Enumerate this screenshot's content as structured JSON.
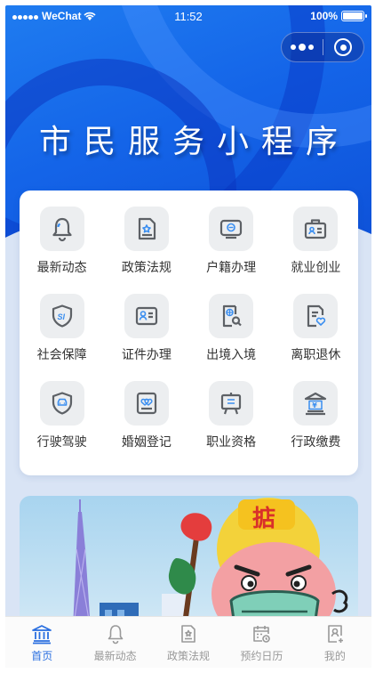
{
  "status_bar": {
    "carrier": "WeChat",
    "time": "11:52",
    "battery": "100%"
  },
  "hero": {
    "title": "市民服务小程序"
  },
  "services": [
    {
      "label": "最新动态",
      "icon": "bell-icon"
    },
    {
      "label": "政策法规",
      "icon": "policy-document-icon"
    },
    {
      "label": "户籍办理",
      "icon": "household-register-icon"
    },
    {
      "label": "就业创业",
      "icon": "briefcase-id-icon"
    },
    {
      "label": "社会保障",
      "icon": "social-security-shield-icon"
    },
    {
      "label": "证件办理",
      "icon": "id-card-icon"
    },
    {
      "label": "出境入境",
      "icon": "passport-search-icon"
    },
    {
      "label": "离职退休",
      "icon": "resignation-heart-icon"
    },
    {
      "label": "行驶驾驶",
      "icon": "car-shield-icon"
    },
    {
      "label": "婚姻登记",
      "icon": "marriage-certificate-icon"
    },
    {
      "label": "职业资格",
      "icon": "presentation-board-icon"
    },
    {
      "label": "行政缴费",
      "icon": "yuan-building-icon"
    }
  ],
  "banner": {
    "mascot_text": "掂"
  },
  "tabbar": {
    "items": [
      {
        "label": "首页",
        "icon": "home-building-icon",
        "active": true
      },
      {
        "label": "最新动态",
        "icon": "bell-icon",
        "active": false
      },
      {
        "label": "政策法规",
        "icon": "policy-document-icon",
        "active": false
      },
      {
        "label": "预约日历",
        "icon": "calendar-icon",
        "active": false
      },
      {
        "label": "我的",
        "icon": "profile-icon",
        "active": false
      }
    ]
  },
  "colors": {
    "primary": "#1464e8",
    "active_tab": "#2a6fe0",
    "icon_gray": "#5d6166"
  }
}
